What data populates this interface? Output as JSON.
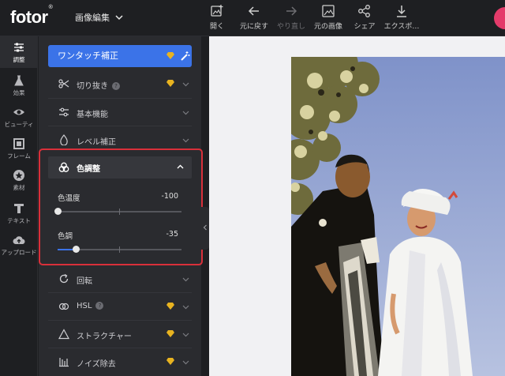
{
  "app": {
    "logo": "fotor",
    "logo_mark": "®",
    "menu_title": "画像編集"
  },
  "toolbar": [
    {
      "label": "開く",
      "icon": "image-add-icon",
      "disabled": false
    },
    {
      "label": "元に戻す",
      "icon": "arrow-left-icon",
      "disabled": false
    },
    {
      "label": "やり直し",
      "icon": "arrow-right-icon",
      "disabled": true
    },
    {
      "label": "元の画像",
      "icon": "image-icon",
      "disabled": false
    },
    {
      "label": "シェア",
      "icon": "share-icon",
      "disabled": false
    },
    {
      "label": "エクスポ…",
      "icon": "download-icon",
      "disabled": false
    }
  ],
  "sidebar": [
    {
      "label": "調整",
      "icon": "sliders-icon",
      "active": true
    },
    {
      "label": "効果",
      "icon": "flask-icon",
      "active": false
    },
    {
      "label": "ビューティ",
      "icon": "eye-icon",
      "active": false
    },
    {
      "label": "フレーム",
      "icon": "frame-icon",
      "active": false
    },
    {
      "label": "素材",
      "icon": "star-icon",
      "active": false
    },
    {
      "label": "テキスト",
      "icon": "text-icon",
      "active": false
    },
    {
      "label": "アップロード",
      "icon": "cloud-upload-icon",
      "active": false
    }
  ],
  "panel": {
    "one_touch": "ワンタッチ補正",
    "items_top": [
      {
        "label": "切り抜き",
        "icon": "scissors-icon",
        "help": "?",
        "premium": true
      },
      {
        "label": "基本機能",
        "icon": "sliders-icon",
        "premium": false
      },
      {
        "label": "レベル補正",
        "icon": "drop-icon",
        "premium": false
      }
    ],
    "color_adjust": {
      "label": "色調整",
      "sliders": [
        {
          "label": "色温度",
          "value": "-100",
          "position": 0.0
        },
        {
          "label": "色調",
          "value": "-35",
          "position": 0.15
        }
      ]
    },
    "items_bottom": [
      {
        "label": "回転",
        "icon": "rotate-icon",
        "premium": false
      },
      {
        "label": "HSL",
        "icon": "hsl-icon",
        "help": "?",
        "premium": true
      },
      {
        "label": "ストラクチャー",
        "icon": "triangle-icon",
        "premium": true
      },
      {
        "label": "ノイズ除去",
        "icon": "denoise-icon",
        "premium": true
      }
    ]
  },
  "colors": {
    "accent": "#3b73e8",
    "highlight_border": "#d9303a",
    "premium_gem": "#e8b320"
  }
}
